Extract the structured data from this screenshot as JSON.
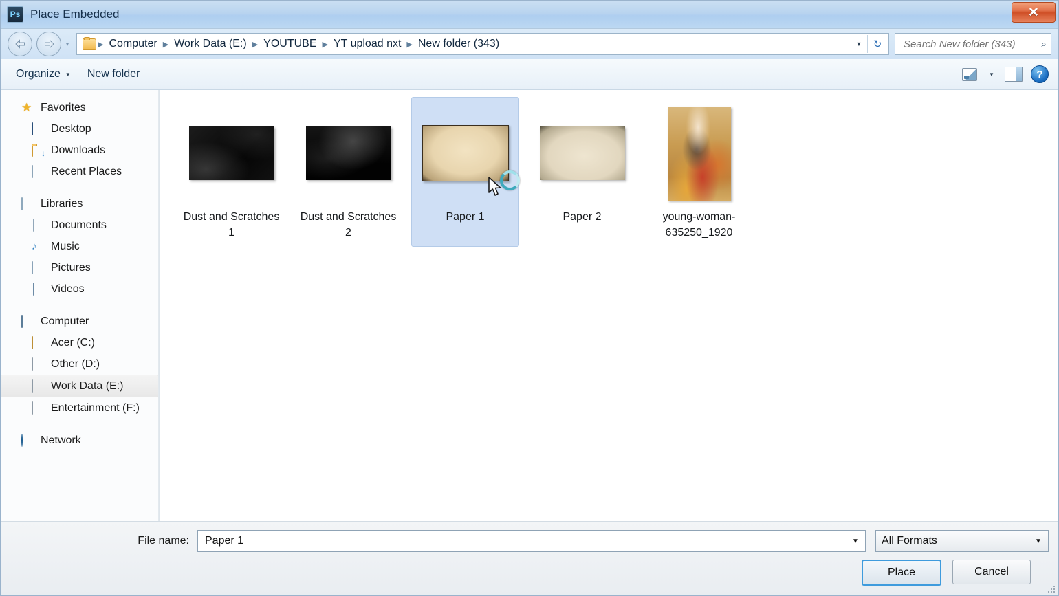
{
  "window": {
    "title": "Place Embedded",
    "app_icon": "photoshop-icon",
    "app_icon_text": "Ps",
    "close_label": "✕"
  },
  "address": {
    "back_icon": "back-arrow-icon",
    "forward_icon": "forward-arrow-icon",
    "history_caret": "▾",
    "folder_icon": "folder-icon",
    "crumbs": [
      {
        "label": "Computer"
      },
      {
        "label": "Work Data (E:)"
      },
      {
        "label": "YOUTUBE"
      },
      {
        "label": "YT upload nxt"
      },
      {
        "label": "New folder (343)"
      }
    ],
    "separator": "▶",
    "dropdown_caret": "▼",
    "refresh_icon": "refresh-icon",
    "refresh_glyph": "↻"
  },
  "search": {
    "placeholder": "Search New folder (343)",
    "value": "",
    "icon": "search-icon",
    "glyph": "⌕"
  },
  "toolbar": {
    "organize_label": "Organize",
    "organize_caret": "▼",
    "new_folder_label": "New folder",
    "view_icon": "view-mode-icon",
    "view_caret": "▼",
    "preview_pane_icon": "preview-pane-icon",
    "help_icon": "help-icon",
    "help_glyph": "?"
  },
  "sidebar": {
    "groups": [
      {
        "root": {
          "label": "Favorites",
          "icon": "star-icon"
        },
        "items": [
          {
            "label": "Desktop",
            "icon": "desktop-icon"
          },
          {
            "label": "Downloads",
            "icon": "downloads-folder-icon"
          },
          {
            "label": "Recent Places",
            "icon": "recent-places-icon"
          }
        ]
      },
      {
        "root": {
          "label": "Libraries",
          "icon": "libraries-icon"
        },
        "items": [
          {
            "label": "Documents",
            "icon": "documents-icon"
          },
          {
            "label": "Music",
            "icon": "music-icon"
          },
          {
            "label": "Pictures",
            "icon": "pictures-icon"
          },
          {
            "label": "Videos",
            "icon": "videos-icon"
          }
        ]
      },
      {
        "root": {
          "label": "Computer",
          "icon": "computer-icon"
        },
        "items": [
          {
            "label": "Acer (C:)",
            "icon": "drive-icon",
            "selected": false
          },
          {
            "label": "Other (D:)",
            "icon": "drive-icon",
            "selected": false
          },
          {
            "label": "Work Data (E:)",
            "icon": "drive-icon",
            "selected": true
          },
          {
            "label": "Entertainment (F:)",
            "icon": "drive-icon",
            "selected": false
          }
        ]
      },
      {
        "root": {
          "label": "Network",
          "icon": "network-icon"
        },
        "items": []
      }
    ]
  },
  "files": [
    {
      "name": "Dust and Scratches 1",
      "thumb": "dust1",
      "selected": false
    },
    {
      "name": "Dust and Scratches 2",
      "thumb": "dust2",
      "selected": false
    },
    {
      "name": "Paper 1",
      "thumb": "paper1",
      "selected": true
    },
    {
      "name": "Paper 2",
      "thumb": "paper2",
      "selected": false
    },
    {
      "name": "young-woman-635250_1920",
      "thumb": "portrait",
      "selected": false
    }
  ],
  "footer": {
    "file_name_label": "File name:",
    "file_name_value": "Paper 1",
    "file_name_caret": "▼",
    "format_value": "All Formats",
    "format_caret": "▼",
    "place_label": "Place",
    "cancel_label": "Cancel"
  },
  "colors": {
    "title_bar": "#b9d4ef",
    "selection": "#cfdff5",
    "close_button": "#cf4f26",
    "default_button_border": "#3e9bdd",
    "search_text": "#6d7d8c"
  }
}
